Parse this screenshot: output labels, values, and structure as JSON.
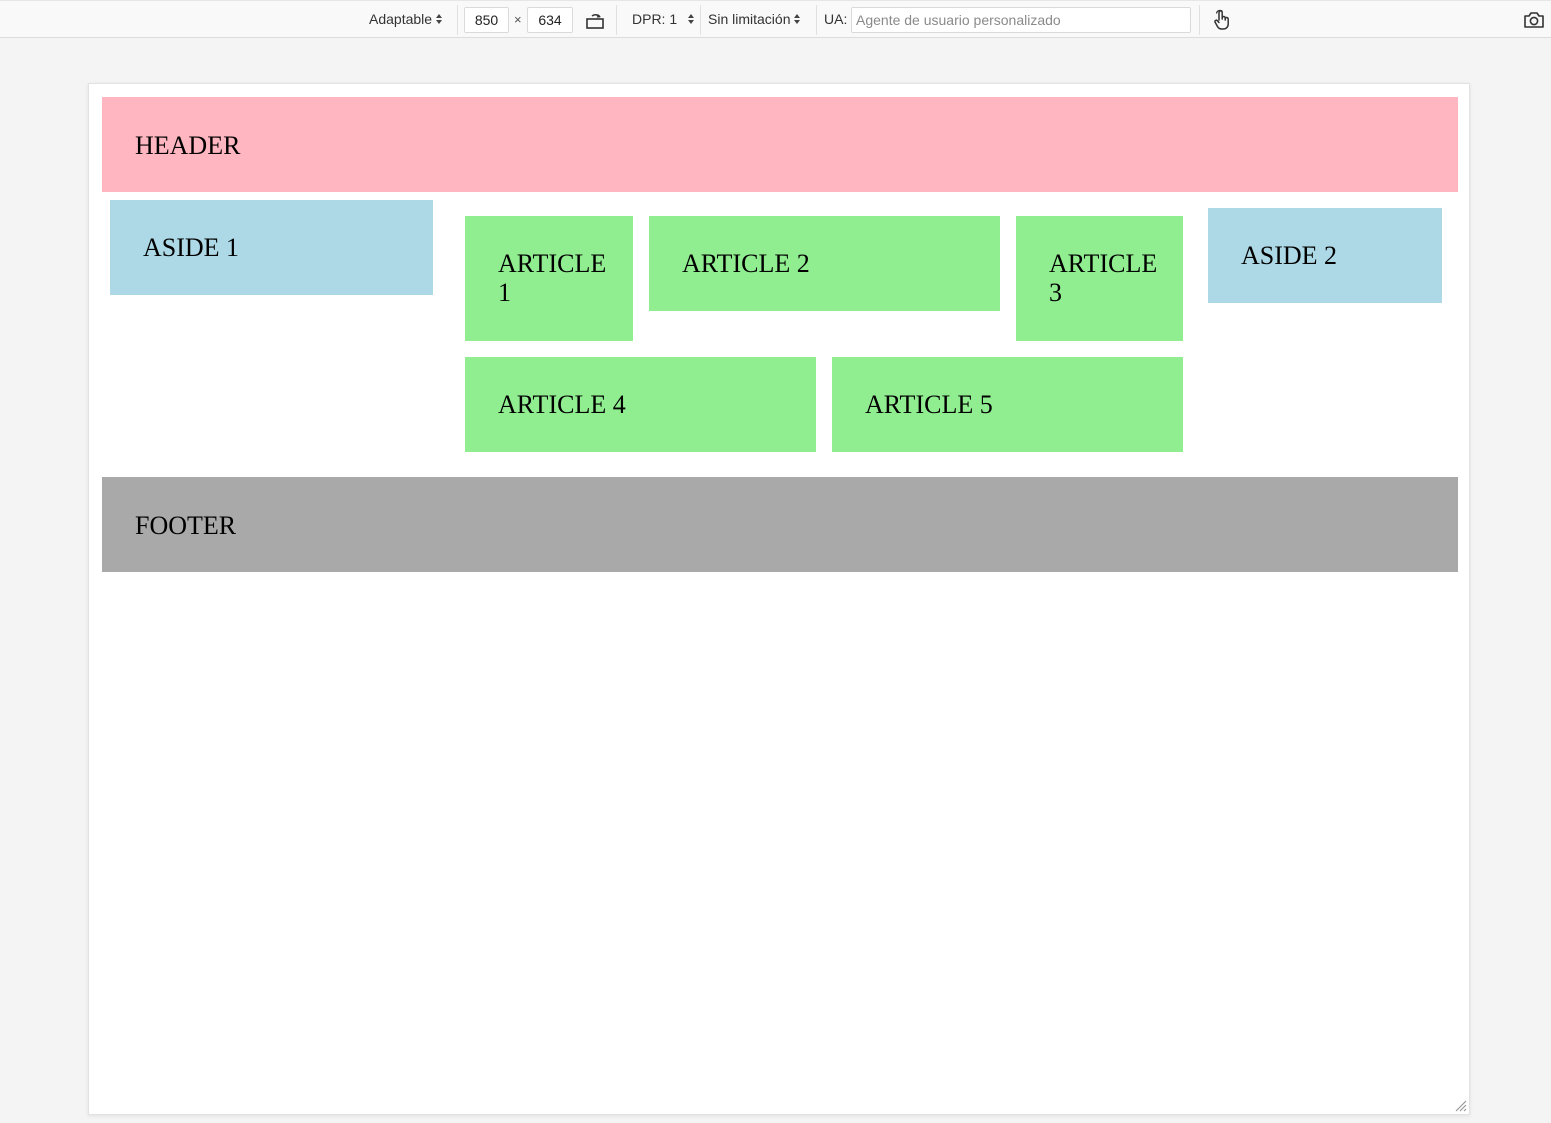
{
  "toolbar": {
    "device_mode": "Adaptable",
    "width_value": "850",
    "times_sign": "×",
    "height_value": "634",
    "dpr_label": "DPR: 1",
    "throttling_label": "Sin limitación",
    "ua_label": "UA:",
    "ua_placeholder": "Agente de usuario personalizado",
    "icons": [
      "rotate-icon",
      "touch-icon",
      "screenshot-icon"
    ]
  },
  "page": {
    "header": "HEADER",
    "aside1": "ASIDE 1",
    "aside2": "ASIDE 2",
    "articles": [
      "ARTICLE 1",
      "ARTICLE 2",
      "ARTICLE 3",
      "ARTICLE 4",
      "ARTICLE 5"
    ],
    "footer": "FOOTER"
  },
  "colors": {
    "header": "#ffb6c1",
    "aside": "#add8e6",
    "article": "#90ee90",
    "footer": "#a9a9a9",
    "canvas": "#f4f4f4"
  }
}
